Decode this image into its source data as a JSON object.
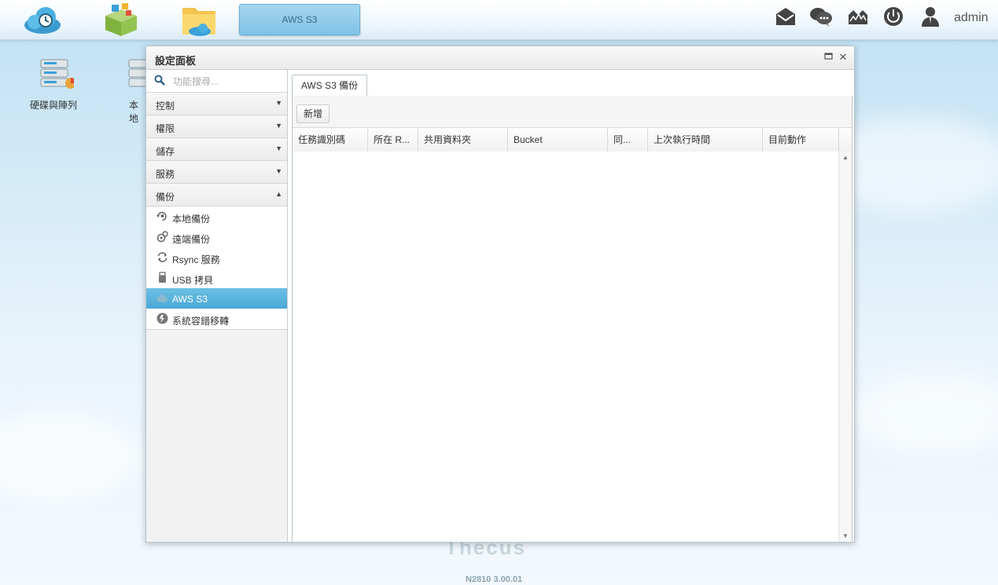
{
  "taskbar": {
    "active_task": "AWS S3",
    "user": "admin"
  },
  "desktop": {
    "icons": [
      {
        "label": "硬碟與陣列"
      },
      {
        "label": "本地"
      }
    ],
    "version": "N2810   3.00.01"
  },
  "window": {
    "title": "設定面板",
    "search_placeholder": "功能搜尋...",
    "categories": [
      {
        "label": "控制",
        "arrow": "▼"
      },
      {
        "label": "權限",
        "arrow": "▼"
      },
      {
        "label": "儲存",
        "arrow": "▼"
      },
      {
        "label": "服務",
        "arrow": "▼"
      },
      {
        "label": "備份",
        "arrow": "▲"
      }
    ],
    "backup_items": [
      {
        "label": "本地備份",
        "icon": "local-backup-icon"
      },
      {
        "label": "遠端備份",
        "icon": "remote-backup-icon"
      },
      {
        "label": "Rsync 服務",
        "icon": "rsync-icon"
      },
      {
        "label": "USB 拷貝",
        "icon": "usb-icon"
      },
      {
        "label": "AWS S3",
        "icon": "cloud-icon",
        "active": true
      },
      {
        "label": "系統容錯移轉",
        "icon": "failover-icon"
      }
    ],
    "tab": "AWS S3 備份",
    "add_button": "新增",
    "columns": [
      "任務識別碼",
      "所在 R...",
      "共用資料夾",
      "Bucket",
      "同...",
      "上次執行時間",
      "目前動作"
    ]
  },
  "colors": {
    "accent": "#4aa8d6",
    "task_button": "#8fcbea"
  }
}
